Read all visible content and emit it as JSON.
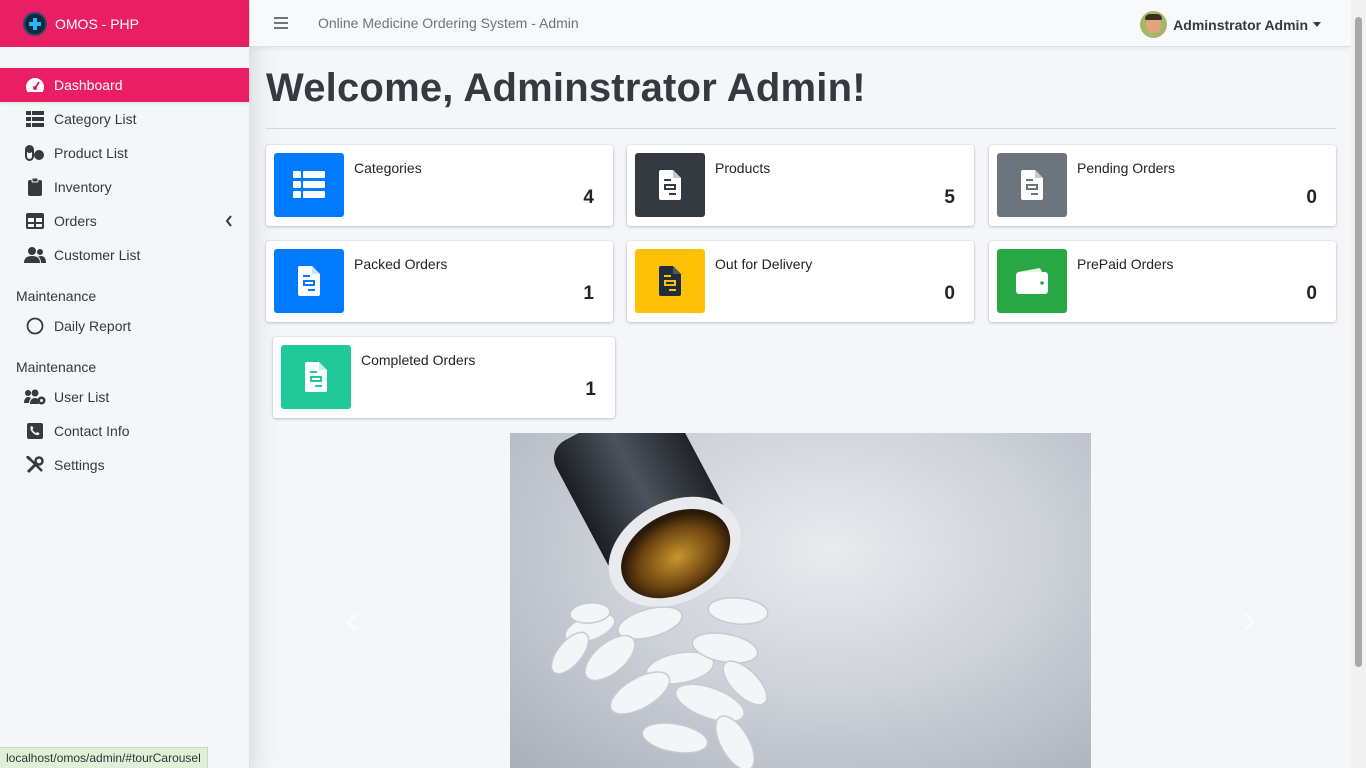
{
  "brand": {
    "name": "OMOS - PHP"
  },
  "topbar": {
    "title": "Online Medicine Ordering System - Admin",
    "user_name": "Adminstrator Admin"
  },
  "sidebar": {
    "items": [
      {
        "label": "Dashboard",
        "icon": "dashboard-icon",
        "active": true
      },
      {
        "label": "Category List",
        "icon": "list-icon"
      },
      {
        "label": "Product List",
        "icon": "pills-icon"
      },
      {
        "label": "Inventory",
        "icon": "clipboard-icon"
      },
      {
        "label": "Orders",
        "icon": "table-icon"
      },
      {
        "label": "Customer List",
        "icon": "users-icon"
      }
    ],
    "section1": "Maintenance",
    "section1_items": [
      {
        "label": "Daily Report",
        "icon": "circle-icon"
      }
    ],
    "section2": "Maintenance",
    "section2_items": [
      {
        "label": "User List",
        "icon": "users-cog-icon"
      },
      {
        "label": "Contact Info",
        "icon": "phone-icon"
      },
      {
        "label": "Settings",
        "icon": "tools-icon"
      }
    ]
  },
  "main": {
    "welcome": "Welcome, Adminstrator Admin!",
    "cards": [
      {
        "label": "Categories",
        "value": "4",
        "color": "#007bff",
        "icon": "th-list-icon"
      },
      {
        "label": "Products",
        "value": "5",
        "color": "#343a40",
        "icon": "file-icon"
      },
      {
        "label": "Pending Orders",
        "value": "0",
        "color": "#6c757d",
        "icon": "file-icon"
      },
      {
        "label": "Packed Orders",
        "value": "1",
        "color": "#007bff",
        "icon": "file-icon"
      },
      {
        "label": "Out for Delivery",
        "value": "0",
        "color": "#ffc107",
        "icon": "file-icon"
      },
      {
        "label": "PrePaid Orders",
        "value": "0",
        "color": "#28a745",
        "icon": "wallet-icon"
      },
      {
        "label": "Completed Orders",
        "value": "1",
        "color": "#20c997",
        "icon": "file-icon"
      }
    ]
  },
  "status_url": "localhost/omos/admin/#tourCarousel",
  "colors": {
    "brand": "#e91e63"
  }
}
